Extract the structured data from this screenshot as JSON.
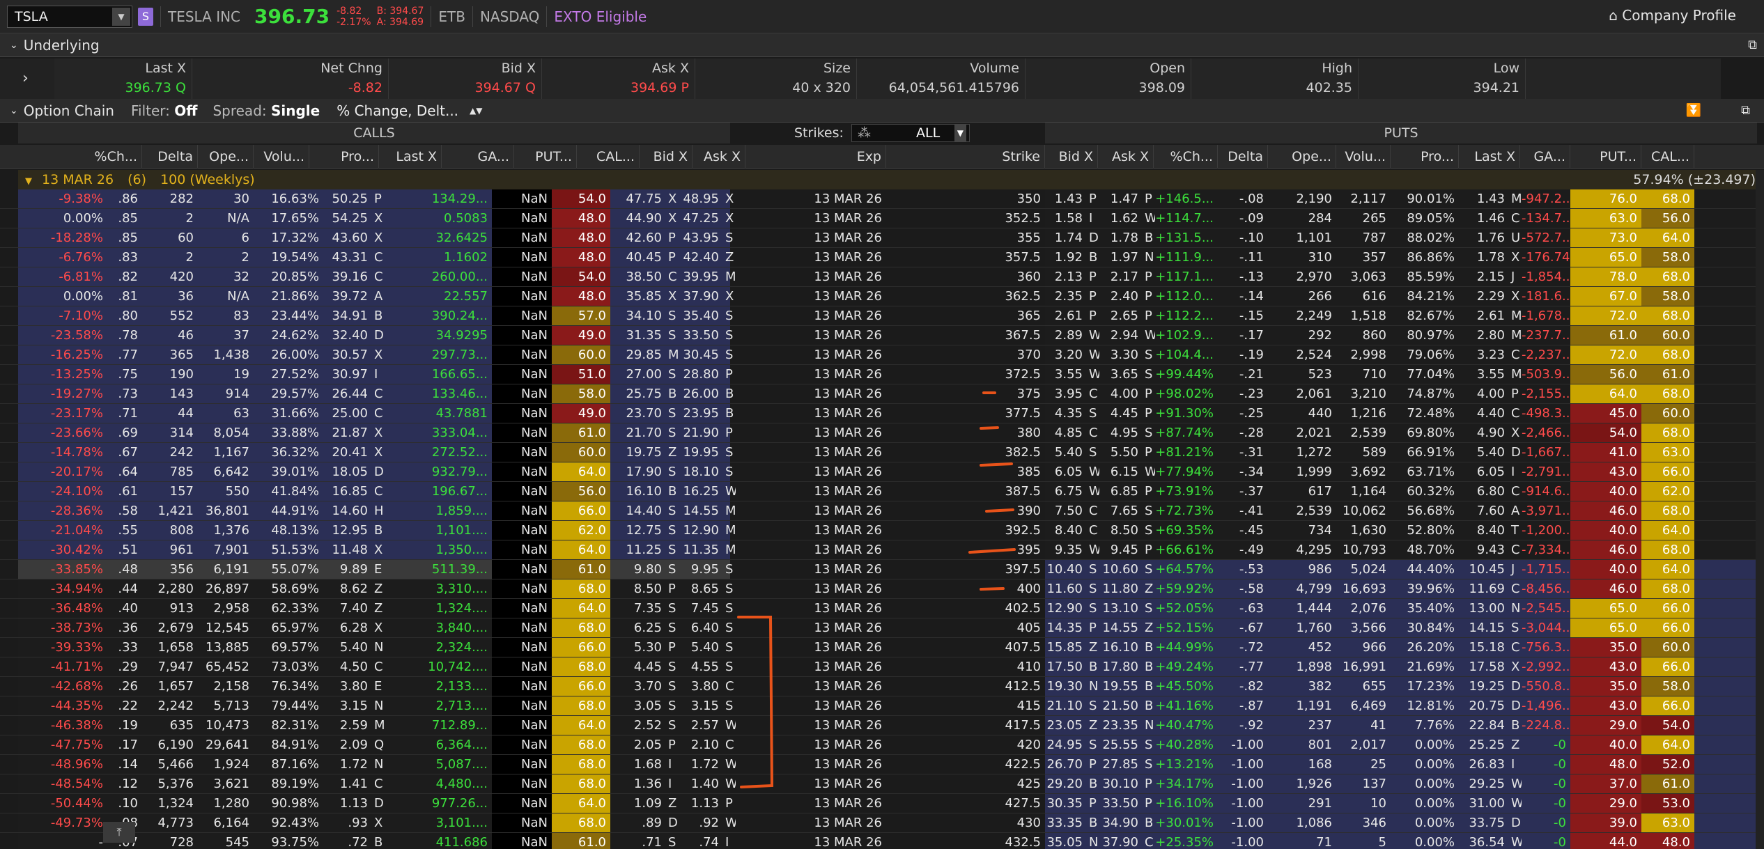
{
  "toolbar": {
    "symbol": "TSLA",
    "badge": "S",
    "name": "TESLA INC",
    "last": "396.73",
    "net_change": "-8.82",
    "pct_change": "-2.17%",
    "bid": "B: 394.67",
    "ask": "A: 394.69",
    "etb": "ETB",
    "exchange": "NASDAQ",
    "exto": "EXTO Eligible",
    "company_profile": "Company Profile"
  },
  "underlying": {
    "title": "Underlying",
    "headers": [
      "Last X",
      "Net Chng",
      "Bid X",
      "Ask X",
      "Size",
      "Volume",
      "Open",
      "High",
      "Low"
    ],
    "last": "396.73",
    "last_x": "Q",
    "net_chng": "-8.82",
    "bid": "394.67",
    "bid_x": "Q",
    "ask": "394.69",
    "ask_x": "P",
    "size": "40 x 320",
    "volume": "64,054,561.415796",
    "open": "398.09",
    "high": "402.35",
    "low": "394.21"
  },
  "chainbar": {
    "title": "Option Chain",
    "filter_label": "Filter:",
    "filter_value": "Off",
    "spread_label": "Spread:",
    "spread_value": "Single",
    "layout": "% Change, Delt..."
  },
  "table": {
    "calls": "CALLS",
    "puts": "PUTS",
    "strikes_label": "Strikes:",
    "strikes_value": "ALL",
    "call_headers": [
      "%Ch...",
      "Delta",
      "Ope...",
      "Volu...",
      "Pro...",
      "Last X",
      "GA...",
      "PUT...",
      "CAL...",
      "Bid X",
      "Ask X"
    ],
    "mid_headers": [
      "Exp",
      "Strike"
    ],
    "put_headers": [
      "Bid X",
      "Ask X",
      "%Ch...",
      "Delta",
      "Ope...",
      "Volu...",
      "Pro...",
      "Last X",
      "GA...",
      "PUT...",
      "CAL..."
    ],
    "group_label": "13 MAR 26",
    "group_count": "(6)",
    "group_type": "100 (Weeklys)",
    "group_iv": "57.94% (±23.497)"
  },
  "rows": [
    [
      "-9.38%",
      ".86",
      "282",
      "30",
      "16.63%",
      "50.25",
      "P",
      "134.29...",
      "NaN",
      "54.0",
      "47.75",
      "X",
      "48.95",
      "X",
      "13 MAR 26",
      "350",
      "1.43",
      "P",
      "1.47",
      "P",
      "+146.5...",
      "-.08",
      "2,190",
      "2,117",
      "90.01%",
      "1.43",
      "M",
      "-947.2...",
      "76.0",
      "68.0"
    ],
    [
      "0.00%",
      ".85",
      "2",
      "N/A",
      "17.65%",
      "54.25",
      "X",
      "0.5083",
      "NaN",
      "48.0",
      "44.90",
      "X",
      "47.25",
      "X",
      "13 MAR 26",
      "352.5",
      "1.58",
      "I",
      "1.62",
      "W",
      "+114.7...",
      "-.09",
      "284",
      "265",
      "89.05%",
      "1.46",
      "C",
      "-134.7...",
      "63.0",
      "56.0"
    ],
    [
      "-18.28%",
      ".85",
      "60",
      "6",
      "17.32%",
      "43.60",
      "X",
      "32.6425",
      "NaN",
      "48.0",
      "42.60",
      "P",
      "43.95",
      "S",
      "13 MAR 26",
      "355",
      "1.74",
      "D",
      "1.78",
      "B",
      "+131.5...",
      "-.10",
      "1,101",
      "787",
      "88.02%",
      "1.76",
      "U",
      "-572.7...",
      "73.0",
      "64.0"
    ],
    [
      "-6.76%",
      ".83",
      "2",
      "2",
      "19.54%",
      "43.31",
      "C",
      "1.1602",
      "NaN",
      "48.0",
      "40.45",
      "P",
      "42.40",
      "Z",
      "13 MAR 26",
      "357.5",
      "1.92",
      "B",
      "1.97",
      "N",
      "+111.9...",
      "-.11",
      "310",
      "357",
      "86.86%",
      "1.78",
      "X",
      "-176.748",
      "65.0",
      "58.0"
    ],
    [
      "-6.81%",
      ".82",
      "420",
      "32",
      "20.85%",
      "39.16",
      "C",
      "260.00...",
      "NaN",
      "54.0",
      "38.50",
      "C",
      "39.95",
      "M",
      "13 MAR 26",
      "360",
      "2.13",
      "P",
      "2.17",
      "P",
      "+117.1...",
      "-.13",
      "2,970",
      "3,063",
      "85.59%",
      "2.15",
      "J",
      "-1,854....",
      "78.0",
      "68.0"
    ],
    [
      "0.00%",
      ".81",
      "36",
      "N/A",
      "21.86%",
      "39.72",
      "A",
      "22.557",
      "NaN",
      "48.0",
      "35.85",
      "X",
      "37.90",
      "X",
      "13 MAR 26",
      "362.5",
      "2.35",
      "P",
      "2.40",
      "P",
      "+112.0...",
      "-.14",
      "266",
      "616",
      "84.21%",
      "2.29",
      "X",
      "-181.6...",
      "67.0",
      "58.0"
    ],
    [
      "-7.10%",
      ".80",
      "552",
      "83",
      "23.44%",
      "34.91",
      "B",
      "390.24...",
      "NaN",
      "57.0",
      "34.10",
      "S",
      "35.40",
      "S",
      "13 MAR 26",
      "365",
      "2.61",
      "P",
      "2.65",
      "P",
      "+112.2...",
      "-.15",
      "2,249",
      "1,518",
      "82.67%",
      "2.61",
      "M",
      "-1,678....",
      "72.0",
      "68.0"
    ],
    [
      "-23.58%",
      ".78",
      "46",
      "37",
      "24.62%",
      "32.40",
      "D",
      "34.9295",
      "NaN",
      "49.0",
      "31.35",
      "S",
      "33.50",
      "S",
      "13 MAR 26",
      "367.5",
      "2.89",
      "W",
      "2.94",
      "W",
      "+102.9...",
      "-.17",
      "292",
      "860",
      "80.97%",
      "2.80",
      "M",
      "-237.7...",
      "61.0",
      "60.0"
    ],
    [
      "-16.25%",
      ".77",
      "365",
      "1,438",
      "26.00%",
      "30.57",
      "X",
      "297.73...",
      "NaN",
      "60.0",
      "29.85",
      "M",
      "30.45",
      "S",
      "13 MAR 26",
      "370",
      "3.20",
      "W",
      "3.30",
      "S",
      "+104.4...",
      "-.19",
      "2,524",
      "2,998",
      "79.06%",
      "3.23",
      "C",
      "-2,237....",
      "72.0",
      "68.0"
    ],
    [
      "-13.25%",
      ".75",
      "190",
      "19",
      "27.52%",
      "30.97",
      "I",
      "166.65...",
      "NaN",
      "51.0",
      "27.00",
      "S",
      "28.80",
      "P",
      "13 MAR 26",
      "372.5",
      "3.55",
      "W",
      "3.65",
      "S",
      "+99.44%",
      "-.21",
      "523",
      "710",
      "77.04%",
      "3.55",
      "M",
      "-503.9...",
      "56.0",
      "61.0"
    ],
    [
      "-19.27%",
      ".73",
      "143",
      "914",
      "29.57%",
      "26.44",
      "C",
      "133.46...",
      "NaN",
      "58.0",
      "25.75",
      "B",
      "26.00",
      "B",
      "13 MAR 26",
      "375",
      "3.95",
      "C",
      "4.00",
      "P",
      "+98.02%",
      "-.23",
      "2,061",
      "3,210",
      "74.87%",
      "4.00",
      "P",
      "-2,155....",
      "64.0",
      "68.0"
    ],
    [
      "-23.17%",
      ".71",
      "44",
      "63",
      "31.66%",
      "25.00",
      "C",
      "43.7881",
      "NaN",
      "49.0",
      "23.70",
      "S",
      "23.95",
      "B",
      "13 MAR 26",
      "377.5",
      "4.35",
      "S",
      "4.45",
      "P",
      "+91.30%",
      "-.25",
      "440",
      "1,216",
      "72.48%",
      "4.40",
      "C",
      "-498.3...",
      "45.0",
      "60.0"
    ],
    [
      "-23.66%",
      ".69",
      "314",
      "8,054",
      "33.88%",
      "21.87",
      "X",
      "333.04...",
      "NaN",
      "61.0",
      "21.70",
      "S",
      "21.90",
      "P",
      "13 MAR 26",
      "380",
      "4.85",
      "C",
      "4.95",
      "S",
      "+87.74%",
      "-.28",
      "2,021",
      "2,539",
      "69.80%",
      "4.90",
      "X",
      "-2,466....",
      "54.0",
      "68.0"
    ],
    [
      "-14.78%",
      ".67",
      "242",
      "1,167",
      "36.32%",
      "20.41",
      "X",
      "272.52...",
      "NaN",
      "60.0",
      "19.75",
      "Z",
      "19.95",
      "S",
      "13 MAR 26",
      "382.5",
      "5.40",
      "S",
      "5.50",
      "P",
      "+81.21%",
      "-.31",
      "1,272",
      "589",
      "66.91%",
      "5.40",
      "D",
      "-1,667....",
      "41.0",
      "63.0"
    ],
    [
      "-20.17%",
      ".64",
      "785",
      "6,642",
      "39.01%",
      "18.05",
      "D",
      "932.79...",
      "NaN",
      "64.0",
      "17.90",
      "S",
      "18.10",
      "S",
      "13 MAR 26",
      "385",
      "6.05",
      "W",
      "6.15",
      "W",
      "+77.94%",
      "-.34",
      "1,999",
      "3,692",
      "63.71%",
      "6.05",
      "I",
      "-2,791....",
      "43.0",
      "66.0"
    ],
    [
      "-24.10%",
      ".61",
      "157",
      "550",
      "41.84%",
      "16.85",
      "C",
      "196.67...",
      "NaN",
      "56.0",
      "16.10",
      "B",
      "16.25",
      "W",
      "13 MAR 26",
      "387.5",
      "6.75",
      "W",
      "6.85",
      "P",
      "+73.91%",
      "-.37",
      "617",
      "1,164",
      "60.32%",
      "6.80",
      "C",
      "-914.6...",
      "40.0",
      "62.0"
    ],
    [
      "-28.36%",
      ".58",
      "1,421",
      "36,801",
      "44.91%",
      "14.60",
      "H",
      "1,859....",
      "NaN",
      "66.0",
      "14.40",
      "S",
      "14.55",
      "M",
      "13 MAR 26",
      "390",
      "7.50",
      "C",
      "7.65",
      "S",
      "+72.73%",
      "-.41",
      "2,539",
      "10,062",
      "56.68%",
      "7.60",
      "A",
      "-3,971....",
      "46.0",
      "68.0"
    ],
    [
      "-21.04%",
      ".55",
      "808",
      "1,376",
      "48.13%",
      "12.95",
      "B",
      "1,101....",
      "NaN",
      "62.0",
      "12.75",
      "S",
      "12.90",
      "M",
      "13 MAR 26",
      "392.5",
      "8.40",
      "C",
      "8.50",
      "S",
      "+69.35%",
      "-.45",
      "734",
      "1,630",
      "52.80%",
      "8.40",
      "T",
      "-1,200....",
      "40.0",
      "64.0"
    ],
    [
      "-30.42%",
      ".51",
      "961",
      "7,901",
      "51.53%",
      "11.48",
      "X",
      "1,350....",
      "NaN",
      "64.0",
      "11.25",
      "S",
      "11.35",
      "M",
      "13 MAR 26",
      "395",
      "9.35",
      "W",
      "9.45",
      "P",
      "+66.61%",
      "-.49",
      "4,295",
      "10,793",
      "48.70%",
      "9.43",
      "C",
      "-7,334....",
      "46.0",
      "68.0"
    ],
    [
      "-33.85%",
      ".48",
      "356",
      "6,191",
      "55.07%",
      "9.89",
      "E",
      "511.39...",
      "NaN",
      "61.0",
      "9.80",
      "S",
      "9.95",
      "S",
      "13 MAR 26",
      "397.5",
      "10.40",
      "S",
      "10.60",
      "S",
      "+64.57%",
      "-.53",
      "986",
      "5,024",
      "44.40%",
      "10.45",
      "J",
      "-1,715....",
      "40.0",
      "64.0"
    ],
    [
      "-34.94%",
      ".44",
      "2,280",
      "26,897",
      "58.69%",
      "8.62",
      "Z",
      "3,310....",
      "NaN",
      "68.0",
      "8.50",
      "P",
      "8.65",
      "S",
      "13 MAR 26",
      "400",
      "11.60",
      "S",
      "11.80",
      "Z",
      "+59.92%",
      "-.58",
      "4,799",
      "16,693",
      "39.96%",
      "11.69",
      "C",
      "-8,456....",
      "46.0",
      "68.0"
    ],
    [
      "-36.48%",
      ".40",
      "913",
      "2,958",
      "62.33%",
      "7.40",
      "Z",
      "1,324....",
      "NaN",
      "64.0",
      "7.35",
      "S",
      "7.45",
      "S",
      "13 MAR 26",
      "402.5",
      "12.90",
      "S",
      "13.10",
      "S",
      "+52.05%",
      "-.63",
      "1,444",
      "2,076",
      "35.40%",
      "13.00",
      "N",
      "-2,545....",
      "65.0",
      "66.0"
    ],
    [
      "-38.73%",
      ".36",
      "2,679",
      "12,545",
      "65.97%",
      "6.28",
      "X",
      "3,840....",
      "NaN",
      "68.0",
      "6.25",
      "S",
      "6.40",
      "S",
      "13 MAR 26",
      "405",
      "14.35",
      "P",
      "14.55",
      "Z",
      "+52.15%",
      "-.67",
      "1,760",
      "3,566",
      "30.84%",
      "14.15",
      "S",
      "-3,044....",
      "65.0",
      "66.0"
    ],
    [
      "-39.33%",
      ".33",
      "1,658",
      "13,885",
      "69.57%",
      "5.40",
      "N",
      "2,324....",
      "NaN",
      "66.0",
      "5.30",
      "P",
      "5.40",
      "S",
      "13 MAR 26",
      "407.5",
      "15.85",
      "Z",
      "16.10",
      "B",
      "+44.99%",
      "-.72",
      "452",
      "966",
      "26.20%",
      "15.18",
      "C",
      "-756.3...",
      "35.0",
      "60.0"
    ],
    [
      "-41.71%",
      ".29",
      "7,947",
      "65,452",
      "73.03%",
      "4.50",
      "C",
      "10,742....",
      "NaN",
      "68.0",
      "4.45",
      "S",
      "4.55",
      "S",
      "13 MAR 26",
      "410",
      "17.50",
      "B",
      "17.80",
      "B",
      "+49.24%",
      "-.77",
      "1,898",
      "16,991",
      "21.69%",
      "17.58",
      "X",
      "-2,992....",
      "43.0",
      "66.0"
    ],
    [
      "-42.68%",
      ".26",
      "1,657",
      "2,158",
      "76.34%",
      "3.80",
      "E",
      "2,133....",
      "NaN",
      "66.0",
      "3.70",
      "S",
      "3.80",
      "C",
      "13 MAR 26",
      "412.5",
      "19.30",
      "N",
      "19.55",
      "B",
      "+45.50%",
      "-.82",
      "382",
      "655",
      "17.23%",
      "19.25",
      "D",
      "-550.8...",
      "35.0",
      "58.0"
    ],
    [
      "-44.35%",
      ".22",
      "2,242",
      "5,713",
      "79.44%",
      "3.15",
      "N",
      "2,713....",
      "NaN",
      "68.0",
      "3.05",
      "S",
      "3.15",
      "S",
      "13 MAR 26",
      "415",
      "21.10",
      "S",
      "21.50",
      "B",
      "+41.16%",
      "-.87",
      "1,191",
      "6,469",
      "12.81%",
      "20.75",
      "D",
      "-1,496....",
      "43.0",
      "66.0"
    ],
    [
      "-46.38%",
      ".19",
      "635",
      "10,473",
      "82.31%",
      "2.59",
      "M",
      "712.89...",
      "NaN",
      "64.0",
      "2.52",
      "S",
      "2.57",
      "W",
      "13 MAR 26",
      "417.5",
      "23.05",
      "Z",
      "23.35",
      "N",
      "+40.47%",
      "-.92",
      "237",
      "41",
      "7.76%",
      "22.84",
      "B",
      "-224.8...",
      "29.0",
      "54.0"
    ],
    [
      "-47.75%",
      ".17",
      "6,190",
      "29,641",
      "84.91%",
      "2.09",
      "Q",
      "6,364....",
      "NaN",
      "68.0",
      "2.05",
      "P",
      "2.10",
      "C",
      "13 MAR 26",
      "420",
      "24.95",
      "S",
      "25.55",
      "S",
      "+40.28%",
      "-1.00",
      "801",
      "2,017",
      "0.00%",
      "25.25",
      "Z",
      "-0",
      "40.0",
      "64.0"
    ],
    [
      "-48.96%",
      ".14",
      "5,466",
      "1,924",
      "87.16%",
      "1.72",
      "N",
      "5,087....",
      "NaN",
      "68.0",
      "1.68",
      "I",
      "1.72",
      "W",
      "13 MAR 26",
      "422.5",
      "26.70",
      "P",
      "27.85",
      "S",
      "+13.21%",
      "-1.00",
      "168",
      "25",
      "0.00%",
      "26.83",
      "I",
      "-0",
      "48.0",
      "52.0"
    ],
    [
      "-48.54%",
      ".12",
      "5,376",
      "3,621",
      "89.19%",
      "1.41",
      "C",
      "4,480....",
      "NaN",
      "68.0",
      "1.36",
      "I",
      "1.40",
      "W",
      "13 MAR 26",
      "425",
      "29.20",
      "B",
      "30.10",
      "P",
      "+34.17%",
      "-1.00",
      "1,926",
      "137",
      "0.00%",
      "29.25",
      "W",
      "-0",
      "37.0",
      "61.0"
    ],
    [
      "-50.44%",
      ".10",
      "1,324",
      "1,280",
      "90.98%",
      "1.13",
      "D",
      "977.26...",
      "NaN",
      "64.0",
      "1.09",
      "Z",
      "1.13",
      "P",
      "13 MAR 26",
      "427.5",
      "30.35",
      "P",
      "33.50",
      "P",
      "+16.10%",
      "-1.00",
      "291",
      "10",
      "0.00%",
      "31.00",
      "W",
      "-0",
      "29.0",
      "53.0"
    ],
    [
      "-49.73%",
      ".08",
      "4,773",
      "6,164",
      "92.43%",
      ".93",
      "X",
      "3,101....",
      "NaN",
      "68.0",
      ".89",
      "D",
      ".92",
      "W",
      "13 MAR 26",
      "430",
      "33.35",
      "B",
      "34.90",
      "B",
      "+30.01%",
      "-1.00",
      "1,086",
      "346",
      "0.00%",
      "33.75",
      "D",
      "-0",
      "39.0",
      "63.0"
    ],
    [
      "-",
      ".07",
      "728",
      "545",
      "93.75%",
      ".72",
      "B",
      "411.686",
      "NaN",
      "61.0",
      ".71",
      "S",
      ".74",
      "I",
      "13 MAR 26",
      "432.5",
      "35.05",
      "N",
      "37.90",
      "C",
      "+25.35%",
      "-1.00",
      "71",
      "5",
      "0.00%",
      "36.54",
      "W",
      "-0",
      "44.0",
      "48.0"
    ]
  ]
}
